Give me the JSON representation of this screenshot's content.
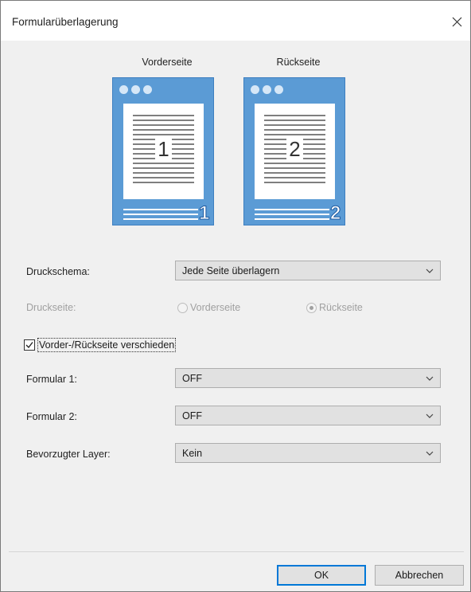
{
  "dialog": {
    "title": "Formularüberlagerung",
    "close_icon": "close-icon"
  },
  "preview": {
    "front_label": "Vorderseite",
    "back_label": "Rückseite",
    "front_number": "1",
    "back_number": "2",
    "accent_color": "#5b9bd5"
  },
  "form": {
    "print_scheme_label": "Druckschema:",
    "print_scheme_value": "Jede Seite überlagern",
    "print_side_label": "Druckseite:",
    "print_side_options": [
      "Vorderseite",
      "Rückseite"
    ],
    "print_side_selected": "Rückseite",
    "different_sides_label": "Vorder-/Rückseite verschieden",
    "different_sides_checked": true,
    "form1_label": "Formular 1:",
    "form1_value": "OFF",
    "form2_label": "Formular 2:",
    "form2_value": "OFF",
    "layer_label": "Bevorzugter Layer:",
    "layer_value": "Kein"
  },
  "buttons": {
    "ok": "OK",
    "cancel": "Abbrechen"
  }
}
